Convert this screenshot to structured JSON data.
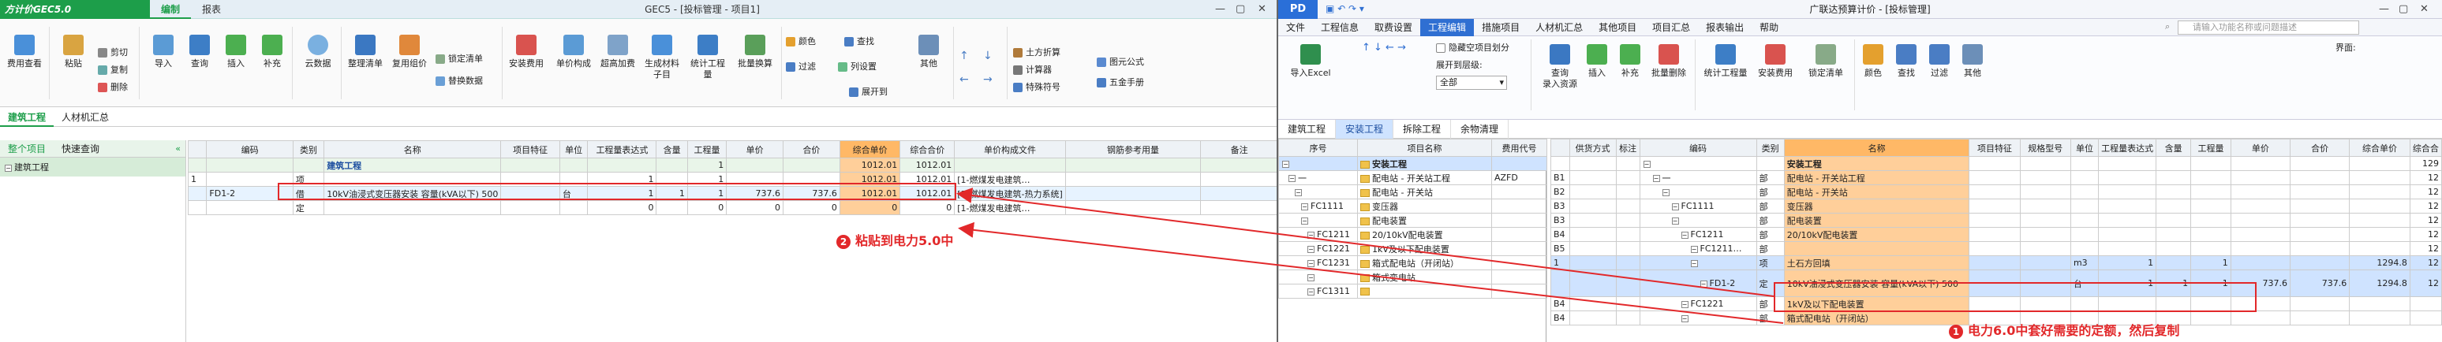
{
  "left": {
    "brand": "方计价GEC5.0",
    "top_tabs": [
      "编制",
      "报表"
    ],
    "window_title": "GEC5 - [投标管理 - 项目1]",
    "ribbon": {
      "big": [
        "费用查看",
        "粘贴",
        "补充",
        "导入",
        "查询",
        "插入",
        "补充",
        "云数据",
        "整理清单",
        "复用组价",
        "安装费用",
        "单价构成",
        "超高加费",
        "生成材料子目",
        "统计工程量",
        "批量换算",
        "其他"
      ],
      "small": [
        "剪切",
        "复制",
        "删除",
        "锁定清单",
        "替换数据",
        "颜色",
        "查找",
        "过滤",
        "列设置",
        "展开到",
        "土方折算",
        "计算器",
        "特殊符号",
        "图元公式",
        "五金手册"
      ]
    },
    "doc_tabs": [
      "建筑工程",
      "人材机汇总"
    ],
    "tree_tabs": [
      "整个项目",
      "快速查询"
    ],
    "tree_root": "建筑工程",
    "grid_headers": [
      "编码",
      "类别",
      "名称",
      "项目特征",
      "单位",
      "工程量表达式",
      "含量",
      "工程量",
      "单价",
      "合价",
      "综合单价",
      "综合合价",
      "单价构成文件",
      "钢筋参考用量",
      "备注"
    ],
    "rows": [
      {
        "n": "",
        "code": "",
        "cat": "",
        "name": "建筑工程",
        "feat": "",
        "unit": "",
        "expr": "",
        "qty_c": "",
        "qty": "1",
        "price": "",
        "total": "",
        "cp": "1012.01",
        "ct": "1012.01",
        "file": "",
        "steel": "",
        "note": ""
      },
      {
        "n": "1",
        "code": "",
        "cat": "项",
        "name": "",
        "feat": "",
        "unit": "",
        "expr": "1",
        "qty_c": "",
        "qty": "1",
        "price": "",
        "total": "",
        "cp": "1012.01",
        "ct": "1012.01",
        "file": "[1-燃煤发电建筑…",
        "steel": "",
        "note": ""
      },
      {
        "n": "",
        "code": "FD1-2",
        "cat": "借",
        "name": "10kV油浸式变压器安装 容量(kVA以下) 500",
        "feat": "",
        "unit": "台",
        "expr": "1",
        "qty_c": "1",
        "qty": "1",
        "price": "737.6",
        "total": "737.6",
        "cp": "1012.01",
        "ct": "1012.01",
        "file": "[1-燃煤发电建筑-热力系统]",
        "steel": "",
        "note": ""
      },
      {
        "n": "",
        "code": "",
        "cat": "定",
        "name": "",
        "feat": "",
        "unit": "",
        "expr": "0",
        "qty_c": "",
        "qty": "0",
        "price": "0",
        "total": "0",
        "cp": "0",
        "ct": "0",
        "file": "[1-燃煤发电建筑…",
        "steel": "",
        "note": ""
      }
    ],
    "annotation": "粘贴到电力5.0中",
    "annotation_num": "2"
  },
  "right": {
    "logo": "PD",
    "window_title": "广联达预算计价 - [投标管理]",
    "search_placeholder": "请输入功能名称或问题描述",
    "menu": [
      "文件",
      "工程信息",
      "取费设置",
      "工程编辑",
      "措施项目",
      "人材机汇总",
      "其他项目",
      "项目汇总",
      "报表输出",
      "帮助"
    ],
    "menu_active": 3,
    "ribbon": {
      "import": "导入Excel",
      "check_hide": "隐藏空项目划分",
      "expand_label": "展开到层级:",
      "expand_value": "全部",
      "big": [
        "查询",
        "录入资源",
        "插入",
        "补充",
        "批量删除",
        "统计工程量",
        "安装费用",
        "锁定清单",
        "颜色",
        "查找",
        "过滤",
        "其他"
      ],
      "page_label": "界面:"
    },
    "doc_tabs": [
      "建筑工程",
      "安装工程",
      "拆除工程",
      "余物清理"
    ],
    "doc_tab_active": 1,
    "tree_headers": [
      "序号",
      "项目名称",
      "费用代号"
    ],
    "tree_rows": [
      {
        "no": "",
        "name": "安装工程",
        "code": "",
        "sel": true,
        "lvl": 0
      },
      {
        "no": "一",
        "name": "配电站 - 开关站工程",
        "code": "AZFD",
        "sel": false,
        "lvl": 1
      },
      {
        "no": "",
        "name": "配电站 - 开关站",
        "code": "",
        "sel": false,
        "lvl": 2
      },
      {
        "no": "FC1111",
        "name": "变压器",
        "code": "",
        "sel": false,
        "lvl": 3
      },
      {
        "no": "",
        "name": "配电装置",
        "code": "",
        "sel": false,
        "lvl": 3
      },
      {
        "no": "FC1211",
        "name": "20/10kV配电装置",
        "code": "",
        "sel": false,
        "lvl": 4
      },
      {
        "no": "FC1221",
        "name": "1kV及以下配电装置",
        "code": "",
        "sel": false,
        "lvl": 4
      },
      {
        "no": "FC1231",
        "name": "箱式配电站（开闭站）",
        "code": "",
        "sel": false,
        "lvl": 4
      },
      {
        "no": "",
        "name": "箱式变电站",
        "code": "",
        "sel": false,
        "lvl": 4
      },
      {
        "no": "FC1311",
        "name": "",
        "code": "",
        "sel": false,
        "lvl": 4
      }
    ],
    "grid_headers": [
      "供货方式",
      "标注",
      "编码",
      "类别",
      "名称",
      "项目特征",
      "规格型号",
      "单位",
      "工程量表达式",
      "含量",
      "工程量",
      "单价",
      "合价",
      "综合单价",
      "综合合"
    ],
    "rows": [
      {
        "rn": "",
        "code": "",
        "cat": "",
        "name": "安装工程",
        "unit": "",
        "expr": "",
        "qty_c": "",
        "qty": "",
        "price": "",
        "total": "",
        "cp": "",
        "ct": "129",
        "lvl": 0,
        "bold": true
      },
      {
        "rn": "B1",
        "code": "一",
        "cat": "部",
        "name": "配电站 - 开关站工程",
        "unit": "",
        "expr": "",
        "qty_c": "",
        "qty": "",
        "price": "",
        "total": "",
        "cp": "",
        "ct": "12",
        "lvl": 1
      },
      {
        "rn": "B2",
        "code": "",
        "cat": "部",
        "name": "配电站 - 开关站",
        "unit": "",
        "expr": "",
        "qty_c": "",
        "qty": "",
        "price": "",
        "total": "",
        "cp": "",
        "ct": "12",
        "lvl": 2
      },
      {
        "rn": "B3",
        "code": "FC1111",
        "cat": "部",
        "name": "变压器",
        "unit": "",
        "expr": "",
        "qty_c": "",
        "qty": "",
        "price": "",
        "total": "",
        "cp": "",
        "ct": "12",
        "lvl": 3
      },
      {
        "rn": "B3",
        "code": "",
        "cat": "部",
        "name": "配电装置",
        "unit": "",
        "expr": "",
        "qty_c": "",
        "qty": "",
        "price": "",
        "total": "",
        "cp": "",
        "ct": "12",
        "lvl": 3
      },
      {
        "rn": "B4",
        "code": "FC1211",
        "cat": "部",
        "name": "20/10kV配电装置",
        "unit": "",
        "expr": "",
        "qty_c": "",
        "qty": "",
        "price": "",
        "total": "",
        "cp": "",
        "ct": "12",
        "lvl": 4
      },
      {
        "rn": "B5",
        "code": "FC1211…",
        "cat": "部",
        "name": "",
        "unit": "",
        "expr": "",
        "qty_c": "",
        "qty": "",
        "price": "",
        "total": "",
        "cp": "",
        "ct": "12",
        "lvl": 5
      },
      {
        "rn": "1",
        "code": "",
        "cat": "项",
        "name": "土石方回填",
        "unit": "m3",
        "expr": "1",
        "qty_c": "",
        "qty": "1",
        "price": "",
        "total": "",
        "cp": "1294.8",
        "ct": "12",
        "lvl": 5,
        "sel": true
      },
      {
        "rn": "",
        "code": "FD1-2",
        "cat": "定",
        "name": "10kV油浸式变压器安装 容量(kVA以下) 500",
        "unit": "台",
        "expr": "1",
        "qty_c": "1",
        "qty": "1",
        "price": "737.6",
        "total": "737.6",
        "cp": "1294.8",
        "ct": "12",
        "lvl": 6,
        "hl": true
      },
      {
        "rn": "B4",
        "code": "FC1221",
        "cat": "部",
        "name": "1kV及以下配电装置",
        "unit": "",
        "expr": "",
        "qty_c": "",
        "qty": "",
        "price": "",
        "total": "",
        "cp": "",
        "ct": "",
        "lvl": 4
      },
      {
        "rn": "B4",
        "code": "",
        "cat": "部",
        "name": "箱式配电站（开闭站）",
        "unit": "",
        "expr": "",
        "qty_c": "",
        "qty": "",
        "price": "",
        "total": "",
        "cp": "",
        "ct": "",
        "lvl": 4
      }
    ],
    "annotation": "电力6.0中套好需要的定额，然后复制",
    "annotation_num": "1"
  },
  "colors": {
    "green": "#1d9e4a",
    "blue": "#2f6fd2",
    "red": "#e2282a",
    "highlight": "#ffcf9a"
  }
}
